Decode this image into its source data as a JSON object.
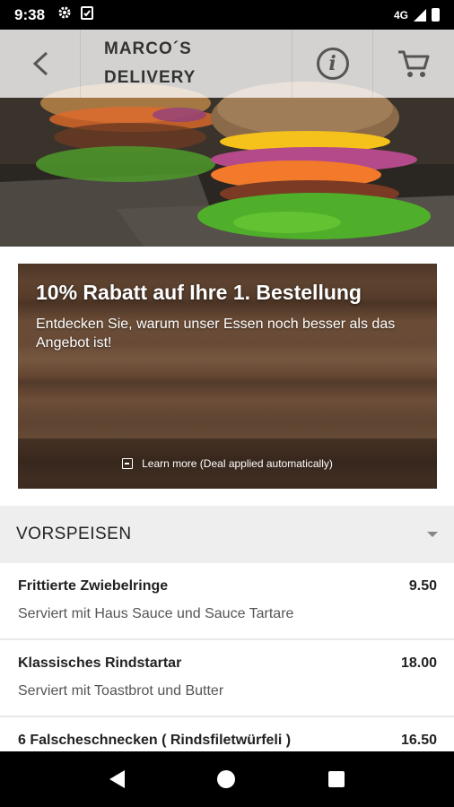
{
  "status_bar": {
    "time": "9:38",
    "network": "4G",
    "icons": [
      "settings-icon",
      "clipboard-check-icon",
      "signal-icon",
      "battery-icon"
    ]
  },
  "app_bar": {
    "title": "MARCO´S\nDELIVERY",
    "icons": [
      "back-arrow-icon",
      "info-icon",
      "cart-icon"
    ]
  },
  "promo": {
    "title": "10% Rabatt auf Ihre 1. Bestellung",
    "subtitle": "Entdecken Sie, warum unser Essen noch besser als das Angebot ist!",
    "link_text": "Learn more (Deal applied automatically)"
  },
  "section": {
    "title": "VORSPEISEN"
  },
  "menu_items": [
    {
      "name": "Frittierte Zwiebelringe",
      "price": "9.50",
      "description": "Serviert mit Haus Sauce und Sauce Tartare"
    },
    {
      "name": "Klassisches Rindstartar",
      "price": "18.00",
      "description": "Serviert mit Toastbrot und Butter"
    },
    {
      "name": "6 Falscheschnecken ( Rindsfiletwürfeli )",
      "price": "16.50",
      "description": ""
    }
  ],
  "colors": {
    "status_bar": "#000000",
    "section_bg": "#eeeeee",
    "promo_wood": "#6d4f3a",
    "text_dark": "#222222"
  }
}
